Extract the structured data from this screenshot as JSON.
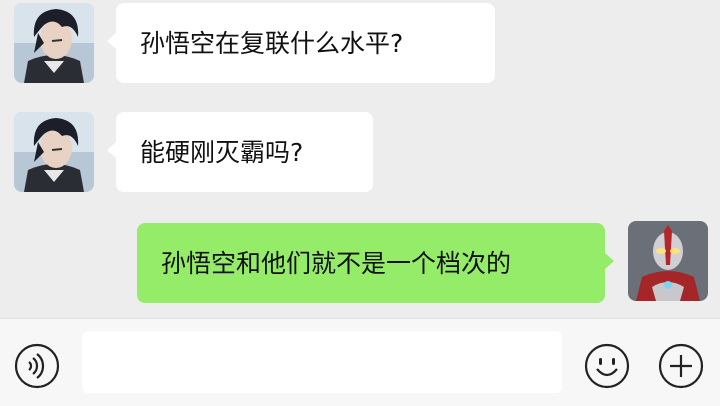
{
  "chat": {
    "messages": [
      {
        "side": "left",
        "avatar": "anime-boy-avatar",
        "text": "孙悟空在复联什么水平?"
      },
      {
        "side": "left",
        "avatar": "anime-boy-avatar",
        "text": "能硬刚灭霸吗?"
      },
      {
        "side": "right",
        "avatar": "ultraman-avatar",
        "text": "孙悟空和他们就不是一个档次的"
      }
    ]
  },
  "input_bar": {
    "icons": [
      "voice-icon",
      "emoji-icon",
      "plus-icon"
    ]
  },
  "colors": {
    "chat_background": "#ededed",
    "incoming_bubble": "#ffffff",
    "outgoing_bubble": "#95ec69",
    "input_bar_background": "#f7f7f7"
  }
}
